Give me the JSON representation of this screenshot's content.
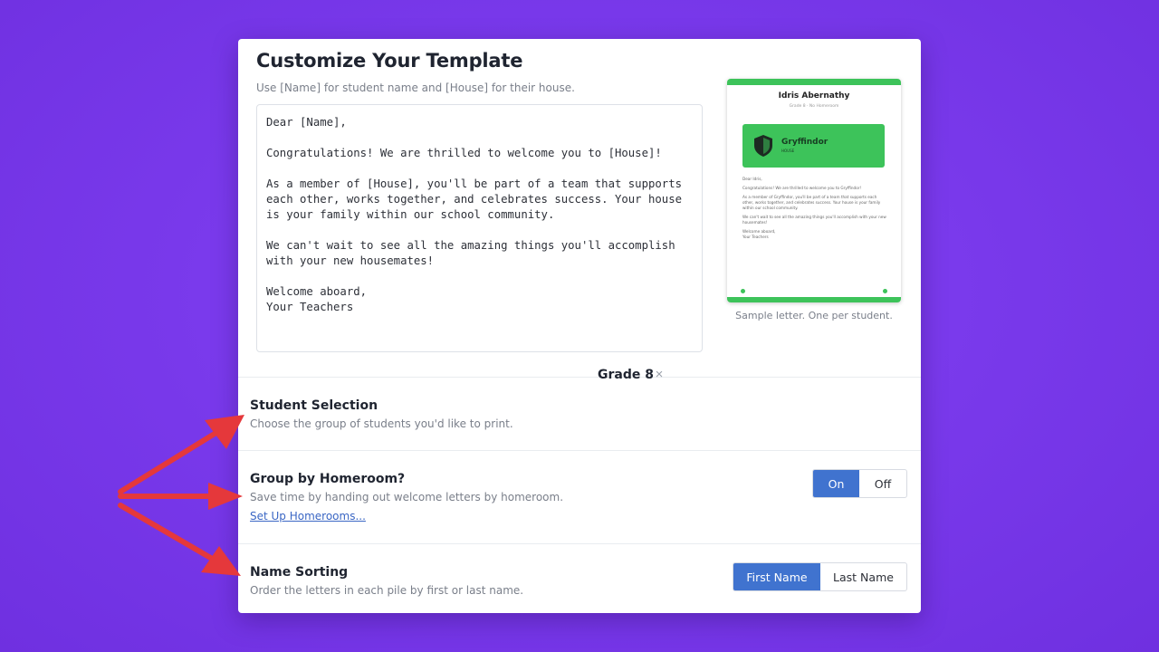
{
  "modal": {
    "title": "Customize Your Template",
    "hint": "Use [Name] for student name and [House] for their house.",
    "template_text": "Dear [Name],\n\nCongratulations! We are thrilled to welcome you to [House]!\n\nAs a member of [House], you'll be part of a team that supports each other, works together, and celebrates success. Your house is your family within our school community.\n\nWe can't wait to see all the amazing things you'll accomplish with your new housemates!\n\nWelcome aboard,\nYour Teachers"
  },
  "preview": {
    "student_name": "Idris Abernathy",
    "meta": "Grade 8 · No Homeroom",
    "house_name": "Gryffindor",
    "house_label": "HOUSE",
    "body": [
      "Dear Idris,",
      "Congratulations! We are thrilled to welcome you to Gryffindor!",
      "As a member of Gryffindor, you'll be part of a team that supports each other, works together, and celebrates success. Your house is your family within our school community.",
      "We can't wait to see all the amazing things you'll accomplish with your new housemates!",
      "Welcome aboard,\nYour Teachers"
    ],
    "caption": "Sample letter. One per student.",
    "accent_color": "#3dc35a"
  },
  "student_selection": {
    "title": "Student Selection",
    "description": "Choose the group of students you'd like to print.",
    "value": "Grade 8",
    "clear_icon": "×"
  },
  "group_by_homeroom": {
    "title": "Group by Homeroom?",
    "description": "Save time by handing out welcome letters by homeroom.",
    "link": "Set Up Homerooms...",
    "options": [
      "On",
      "Off"
    ],
    "selected": "On"
  },
  "name_sorting": {
    "title": "Name Sorting",
    "description": "Order the letters in each pile by first or last name.",
    "options": [
      "First Name",
      "Last Name"
    ],
    "selected": "First Name"
  },
  "colors": {
    "background": "#7a3aec",
    "primary": "#4073cf",
    "annotation_arrow": "#e5383b"
  }
}
